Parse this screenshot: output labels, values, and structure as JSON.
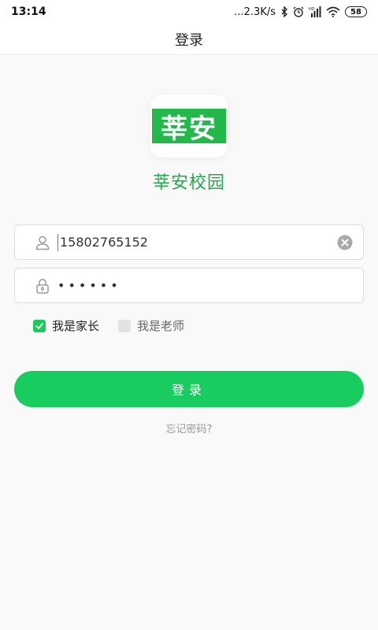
{
  "status_bar": {
    "time": "13:14",
    "network_speed": "...2.3K/s",
    "battery": "58",
    "icons": [
      "bluetooth-icon",
      "alarm-icon",
      "hd-signal-icon",
      "wifi-icon",
      "battery-icon"
    ]
  },
  "header": {
    "title": "登录"
  },
  "logo": {
    "text": "莘安",
    "color": "#23b84a"
  },
  "app_name": "莘安校园",
  "phone_input": {
    "value": "15802765152",
    "icon": "user-icon"
  },
  "password_input": {
    "value": "••••••",
    "icon": "lock-icon"
  },
  "roles": [
    {
      "label": "我是家长",
      "checked": true
    },
    {
      "label": "我是老师",
      "checked": false
    }
  ],
  "login_button": {
    "label": "登录"
  },
  "forgot_password": "忘记密码?",
  "colors": {
    "brand": "#19cc5f",
    "logo_green": "#23b84a",
    "app_name": "#1faa4c"
  }
}
